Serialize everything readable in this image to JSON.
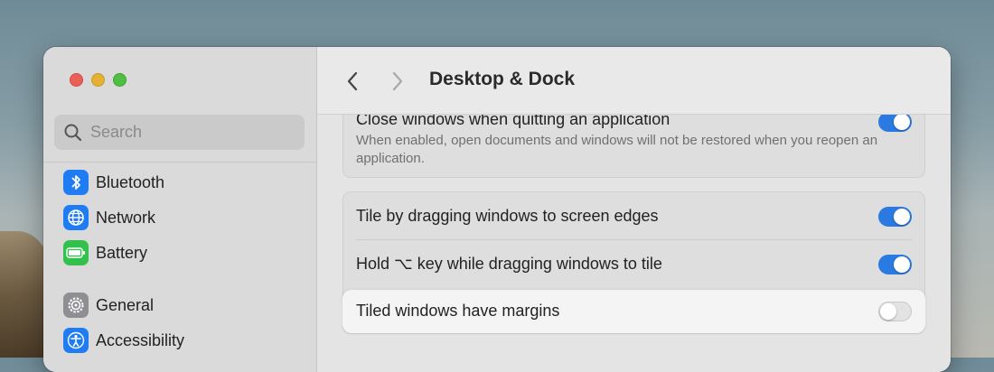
{
  "window": {
    "controls": [
      "close",
      "minimize",
      "zoom"
    ]
  },
  "sidebar": {
    "search": {
      "placeholder": "Search",
      "icon": "search-icon"
    },
    "items": [
      {
        "label": "Bluetooth",
        "icon": "bluetooth-icon",
        "color": "#1f7cf2"
      },
      {
        "label": "Network",
        "icon": "globe-icon",
        "color": "#1f7cf2"
      },
      {
        "label": "Battery",
        "icon": "battery-icon",
        "color": "#33c14e"
      },
      {
        "label": "General",
        "icon": "gear-icon",
        "color": "#8e8e93"
      },
      {
        "label": "Accessibility",
        "icon": "accessibility-icon",
        "color": "#1f7cf2"
      }
    ]
  },
  "toolbar": {
    "back_icon": "chevron-left-icon",
    "forward_icon": "chevron-right-icon",
    "title": "Desktop & Dock"
  },
  "settings": {
    "close_windows": {
      "label": "Close windows when quitting an application",
      "description": "When enabled, open documents and windows will not be restored when you reopen an application.",
      "enabled": true
    },
    "tiling": [
      {
        "label": "Tile by dragging windows to screen edges",
        "enabled": true
      },
      {
        "label": "Hold ⌥ key while dragging windows to tile",
        "enabled": true
      },
      {
        "label": "Tiled windows have margins",
        "enabled": false
      }
    ]
  },
  "colors": {
    "accent": "#2a7ae2"
  }
}
